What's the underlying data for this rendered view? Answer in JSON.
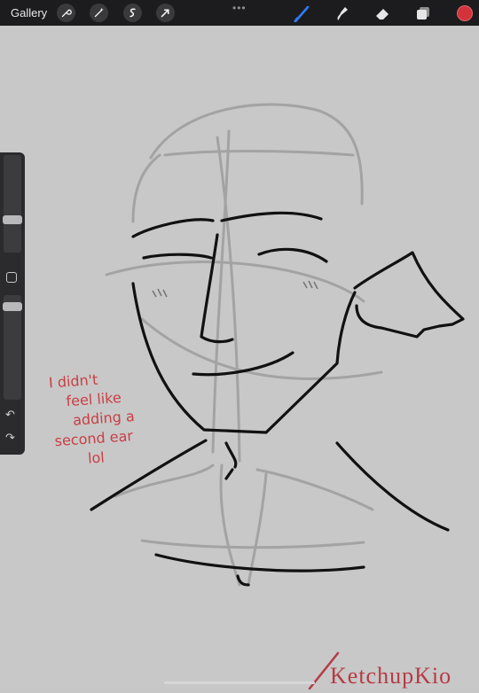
{
  "topbar": {
    "gallery_label": "Gallery",
    "left_tools": [
      "wrench-icon",
      "magic-wand-icon",
      "selection-icon",
      "transform-arrow-icon"
    ],
    "more_label": "•••",
    "right_tools": [
      "brush-icon",
      "smudge-icon",
      "eraser-icon",
      "layers-icon"
    ],
    "active_color": "#d3333b",
    "brush_accent": "#2e7bf6"
  },
  "canvas": {
    "background": "#c8c8c8",
    "note_lines": [
      "I didn't",
      "feel like",
      "adding a",
      "second ear",
      "lol"
    ],
    "signature": "KetchupKio"
  },
  "sidebar": {
    "size_slider_value": 0.28,
    "opacity_slider_value": 0.14,
    "undo_icon": "undo-icon",
    "redo_icon": "redo-icon"
  }
}
